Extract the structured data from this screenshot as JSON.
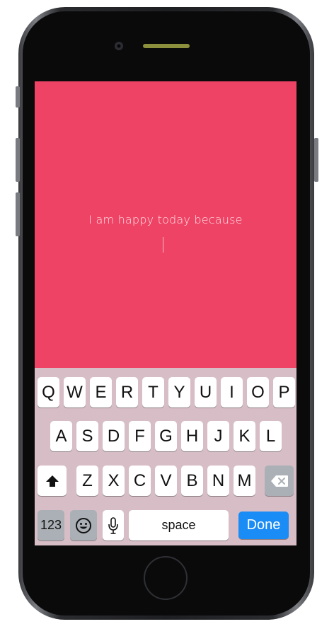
{
  "screen": {
    "prompt": "I am happy today because",
    "background": "#ef4365"
  },
  "keyboard": {
    "row1": [
      "Q",
      "W",
      "E",
      "R",
      "T",
      "Y",
      "U",
      "I",
      "O",
      "P"
    ],
    "row2": [
      "A",
      "S",
      "D",
      "F",
      "G",
      "H",
      "J",
      "K",
      "L"
    ],
    "row3": [
      "Z",
      "X",
      "C",
      "V",
      "B",
      "N",
      "M"
    ],
    "numbers_label": "123",
    "space_label": "space",
    "done_label": "Done",
    "shift_icon": "shift-icon",
    "delete_icon": "delete-icon",
    "emoji_icon": "emoji-icon",
    "mic_icon": "microphone-icon",
    "accent": "#1a8cf5"
  }
}
